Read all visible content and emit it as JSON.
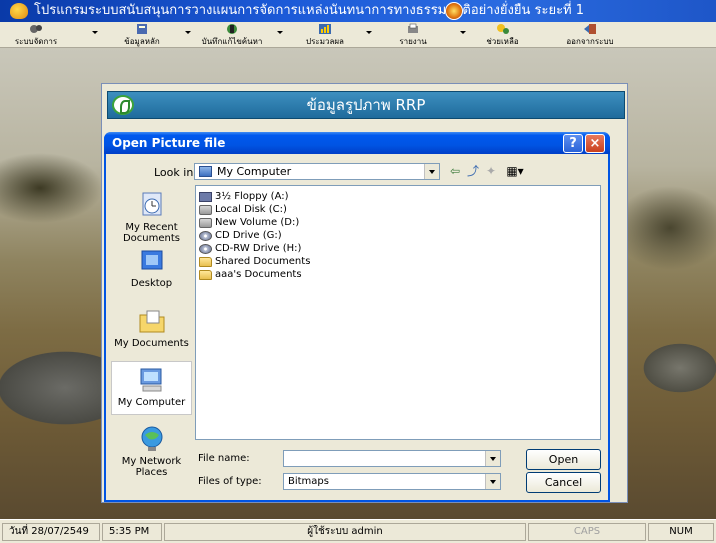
{
  "app": {
    "title": "โปรแกรมระบบสนับสนุนการวางแผนการจัดการแหล่งนันทนาการทางธรรมชาติอย่างยั่งยืน ระยะที่ 1"
  },
  "toolbar": {
    "items": [
      {
        "label": "ระบบจัดการ",
        "icon": "system-icon"
      },
      {
        "label": "ข้อมูลหลัก",
        "icon": "data-icon"
      },
      {
        "label": "บันทึกแก้ไขค้นหา",
        "icon": "edit-icon"
      },
      {
        "label": "ประมวลผล",
        "icon": "process-icon"
      },
      {
        "label": "รายงาน",
        "icon": "report-icon"
      },
      {
        "label": "ช่วยเหลือ",
        "icon": "help-icon"
      },
      {
        "label": "ออกจากระบบ",
        "icon": "exit-icon"
      }
    ]
  },
  "rrp": {
    "header": "ข้อมูลรูปภาพ RRP"
  },
  "dialog": {
    "title": "Open Picture file",
    "help_btn": "?",
    "close_btn": "×",
    "look_in_label": "Look in:",
    "look_in_value": "My Computer",
    "places": [
      {
        "label": "My Recent Documents",
        "icon": "recent-documents-icon"
      },
      {
        "label": "Desktop",
        "icon": "desktop-icon"
      },
      {
        "label": "My Documents",
        "icon": "my-documents-icon"
      },
      {
        "label": "My Computer",
        "icon": "my-computer-icon"
      },
      {
        "label": "My Network Places",
        "icon": "network-places-icon"
      }
    ],
    "files": [
      {
        "label": "3½ Floppy (A:)",
        "icon": "floppy-icon"
      },
      {
        "label": "Local Disk (C:)",
        "icon": "drive-icon"
      },
      {
        "label": "New Volume (D:)",
        "icon": "drive-icon"
      },
      {
        "label": "CD Drive (G:)",
        "icon": "cd-icon"
      },
      {
        "label": "CD-RW Drive (H:)",
        "icon": "cd-icon"
      },
      {
        "label": "Shared Documents",
        "icon": "folder-icon"
      },
      {
        "label": "aaa's Documents",
        "icon": "folder-icon"
      }
    ],
    "file_name_label": "File name:",
    "file_name_value": "",
    "file_type_label": "Files of type:",
    "file_type_value": "Bitmaps",
    "open_btn": "Open",
    "cancel_btn": "Cancel"
  },
  "status": {
    "date": "วันที่ 28/07/2549",
    "time": "5:35 PM",
    "user": "ผู้ใช้ระบบ admin",
    "caps": "CAPS",
    "num": "NUM"
  }
}
